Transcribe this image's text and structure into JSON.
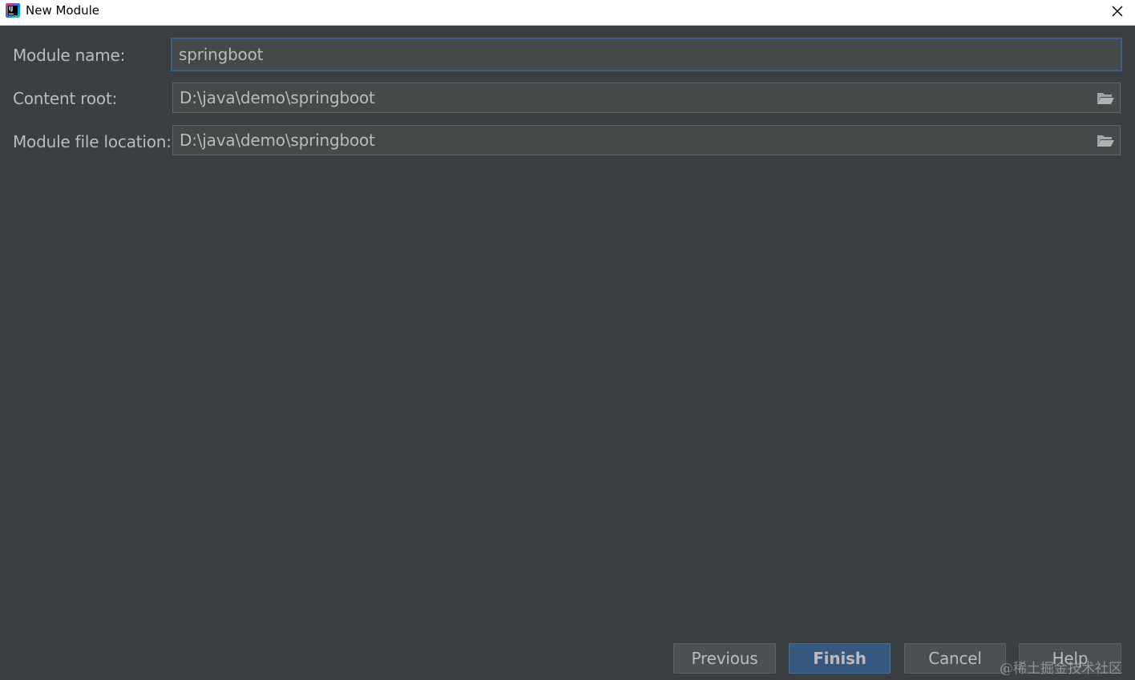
{
  "window": {
    "title": "New Module",
    "icons": {
      "app": "intellij-idea-icon",
      "close": "close-icon",
      "browse": "folder-open-icon"
    }
  },
  "form": {
    "module_name": {
      "label": "Module name:",
      "value": "springboot"
    },
    "content_root": {
      "label": "Content root:",
      "value": "D:\\java\\demo\\springboot"
    },
    "module_file_location": {
      "label": "Module file location:",
      "value": "D:\\java\\demo\\springboot"
    }
  },
  "buttons": {
    "previous": "Previous",
    "finish": "Finish",
    "cancel": "Cancel",
    "help": "Help"
  },
  "watermark": "@稀土掘金技术社区",
  "colors": {
    "background": "#3c3f41",
    "field_bg": "#45494a",
    "focus_border": "#3d6185",
    "primary_button": "#365880",
    "text": "#bbbbbb"
  }
}
